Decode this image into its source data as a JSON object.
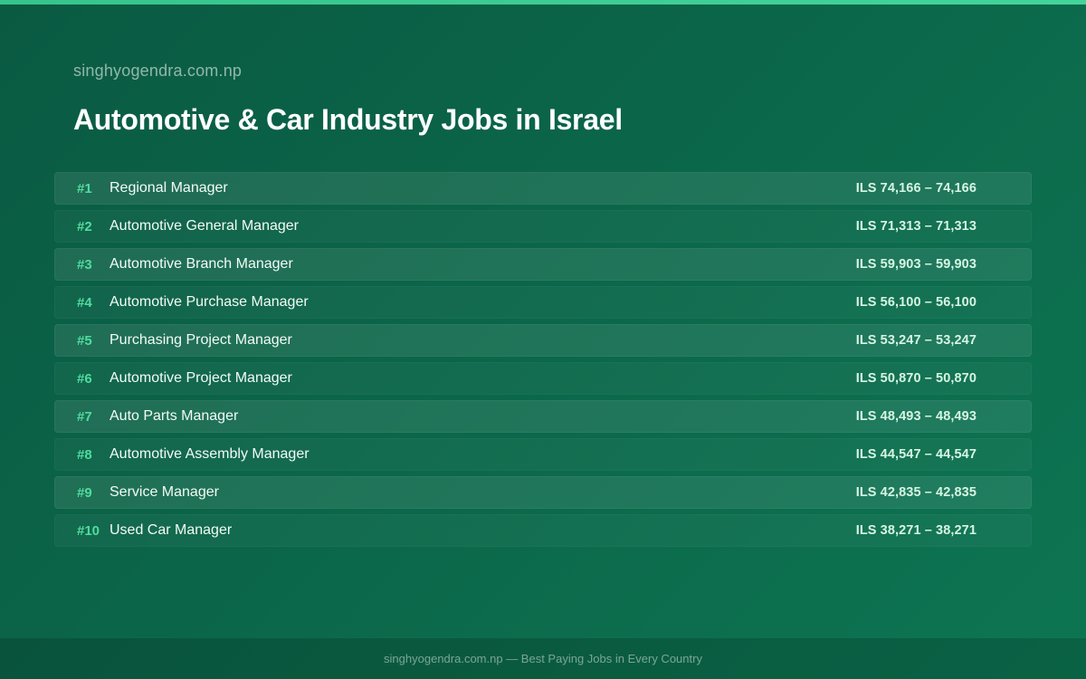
{
  "header": {
    "site_name": "singhyogendra.com.np",
    "title": "Automotive & Car Industry Jobs in Israel"
  },
  "jobs": [
    {
      "rank": "#1",
      "title": "Regional Manager",
      "salary": "ILS 74,166 – 74,166"
    },
    {
      "rank": "#2",
      "title": "Automotive General Manager",
      "salary": "ILS 71,313 – 71,313"
    },
    {
      "rank": "#3",
      "title": "Automotive Branch Manager",
      "salary": "ILS 59,903 – 59,903"
    },
    {
      "rank": "#4",
      "title": "Automotive Purchase Manager",
      "salary": "ILS 56,100 – 56,100"
    },
    {
      "rank": "#5",
      "title": "Purchasing Project Manager",
      "salary": "ILS 53,247 – 53,247"
    },
    {
      "rank": "#6",
      "title": "Automotive Project Manager",
      "salary": "ILS 50,870 – 50,870"
    },
    {
      "rank": "#7",
      "title": "Auto Parts Manager",
      "salary": "ILS 48,493 – 48,493"
    },
    {
      "rank": "#8",
      "title": "Automotive Assembly Manager",
      "salary": "ILS 44,547 – 44,547"
    },
    {
      "rank": "#9",
      "title": "Service Manager",
      "salary": "ILS 42,835 – 42,835"
    },
    {
      "rank": "#10",
      "title": "Used Car Manager",
      "salary": "ILS 38,271 – 38,271"
    }
  ],
  "footer": {
    "text": "singhyogendra.com.np — Best Paying Jobs in Every Country"
  },
  "colors": {
    "accent": "#4fdc9f",
    "background": "#0b6649"
  }
}
